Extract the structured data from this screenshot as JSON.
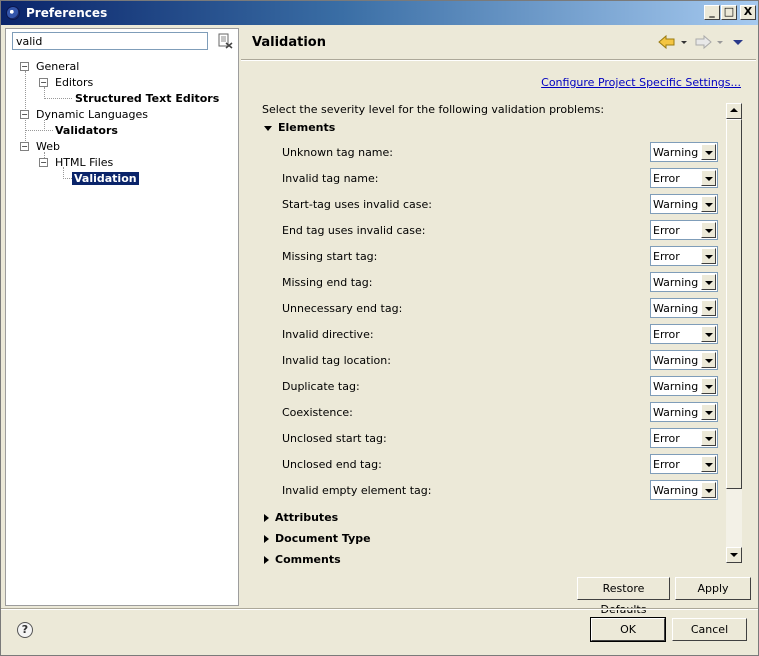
{
  "window": {
    "title": "Preferences",
    "controls": {
      "minimize": "_",
      "maximize": "□",
      "close": "X"
    }
  },
  "filter": {
    "value": "valid"
  },
  "tree": [
    {
      "label": "General",
      "expander": "−",
      "bold": false
    },
    {
      "label": "Editors",
      "expander": "−",
      "bold": false
    },
    {
      "label": "Structured Text Editors",
      "bold": true
    },
    {
      "label": "Dynamic Languages",
      "expander": "−",
      "bold": false
    },
    {
      "label": "Validators",
      "bold": true
    },
    {
      "label": "Web",
      "expander": "−",
      "bold": false
    },
    {
      "label": "HTML Files",
      "expander": "−",
      "bold": false
    },
    {
      "label": "Validation",
      "bold": true,
      "selected": true
    }
  ],
  "page": {
    "title": "Validation",
    "project_link": "Configure Project Specific Settings...",
    "intro": "Select the severity level for the following validation problems:"
  },
  "sections": {
    "elements": "Elements",
    "attributes": "Attributes",
    "document_type": "Document Type",
    "comments": "Comments"
  },
  "options": [
    {
      "label": "Unknown tag name:",
      "value": "Warning"
    },
    {
      "label": "Invalid tag name:",
      "value": "Error"
    },
    {
      "label": "Start-tag uses invalid case:",
      "value": "Warning"
    },
    {
      "label": "End tag uses invalid case:",
      "value": "Error"
    },
    {
      "label": "Missing start tag:",
      "value": "Error"
    },
    {
      "label": "Missing end tag:",
      "value": "Warning"
    },
    {
      "label": "Unnecessary end tag:",
      "value": "Warning"
    },
    {
      "label": "Invalid directive:",
      "value": "Error"
    },
    {
      "label": "Invalid tag location:",
      "value": "Warning"
    },
    {
      "label": "Duplicate tag:",
      "value": "Warning"
    },
    {
      "label": "Coexistence:",
      "value": "Warning"
    },
    {
      "label": "Unclosed start tag:",
      "value": "Error"
    },
    {
      "label": "Unclosed end tag:",
      "value": "Error"
    },
    {
      "label": "Invalid empty element tag:",
      "value": "Warning"
    }
  ],
  "buttons": {
    "restore_defaults": "Restore Defaults",
    "apply": "Apply",
    "ok": "OK",
    "cancel": "Cancel"
  },
  "help": "?",
  "colors": {
    "link": "#0000c0",
    "selection": "#0a246a",
    "titlebar": "#0a246a"
  }
}
